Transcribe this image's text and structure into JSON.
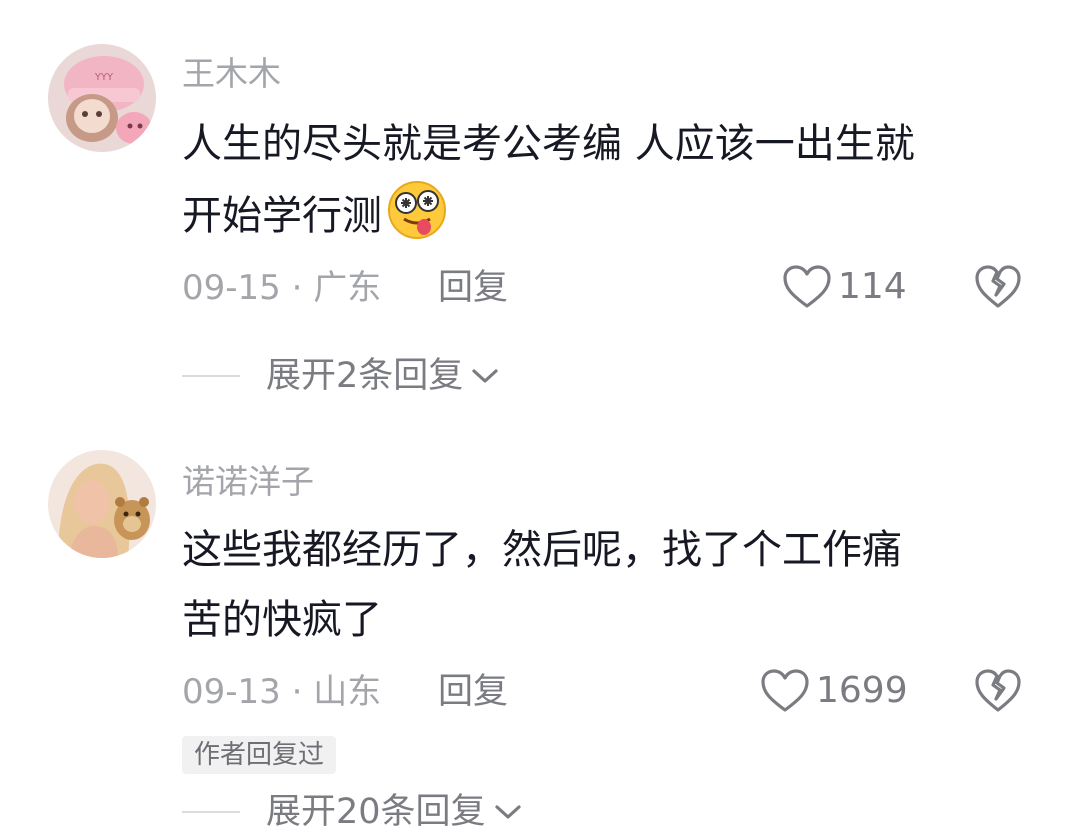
{
  "comments": [
    {
      "username": "王木木",
      "text_lines": [
        "人生的尽头就是考公考编 人应该一出生就",
        "开始学行测"
      ],
      "date_location": "09-15 · 广东",
      "reply_label": "回复",
      "like_count": "114",
      "expand_label": "展开2条回复"
    },
    {
      "username": "诺诺洋子",
      "text_lines": [
        "这些我都经历了，然后呢，找了个工作痛",
        "苦的快疯了"
      ],
      "date_location": "09-13 · 山东",
      "reply_label": "回复",
      "like_count": "1699",
      "badge": "作者回复过",
      "expand_label": "展开20条回复"
    }
  ],
  "icons": {
    "like": "heart-outline-icon",
    "dislike": "broken-heart-icon",
    "expand": "chevron-down-icon",
    "emoji": "crazy-tongue-out-emoji"
  },
  "colors": {
    "text": "#161823",
    "meta": "#a4a5aa",
    "action": "#7b7c82"
  }
}
